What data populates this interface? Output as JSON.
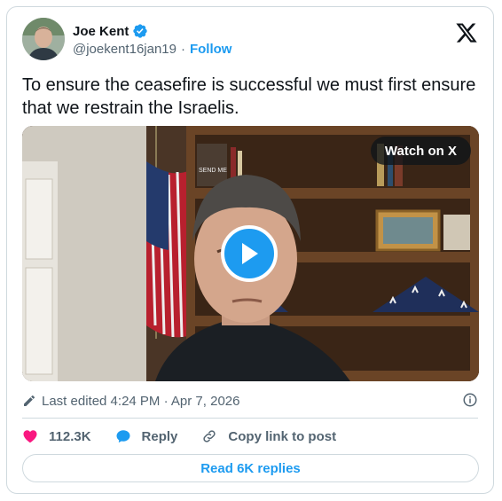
{
  "author": {
    "name": "Joe Kent",
    "handle": "@joekent16jan19",
    "separator": "·",
    "follow_label": "Follow"
  },
  "tweet": {
    "text": "To ensure the ceasefire is successful we must first ensure that we restrain the Israelis."
  },
  "video": {
    "watch_label": "Watch on X",
    "book_title": "SEND ME"
  },
  "meta": {
    "edited_text": "Last edited 4:24 PM · Apr 7, 2026"
  },
  "actions": {
    "like_count": "112.3K",
    "reply_label": "Reply",
    "copy_link_label": "Copy link to post"
  },
  "footer": {
    "read_replies_label": "Read 6K replies"
  },
  "colors": {
    "accent": "#1d9bf0",
    "like": "#f91880",
    "text": "#0f1419",
    "muted": "#536471",
    "border": "#cfd9de"
  },
  "icons": [
    "verified-badge-icon",
    "x-logo-icon",
    "play-icon",
    "pencil-icon",
    "info-icon",
    "heart-icon",
    "reply-bubble-icon",
    "link-icon"
  ]
}
